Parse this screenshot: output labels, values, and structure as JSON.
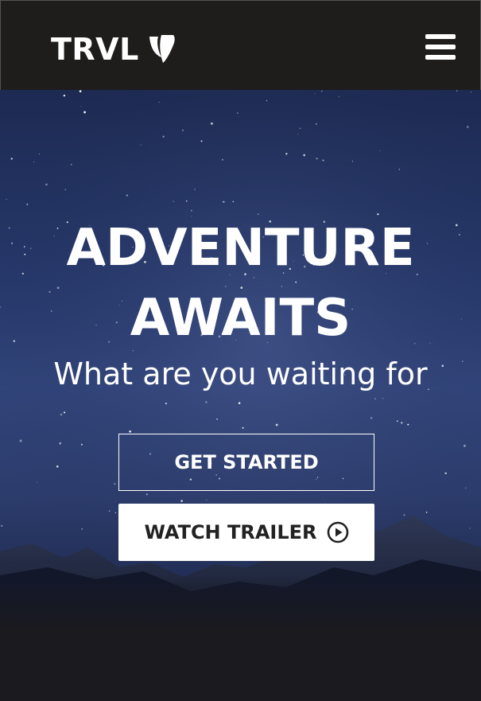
{
  "header": {
    "logo_text": "TRVL",
    "logo_mark_icon": "typo3-shield-icon",
    "menu_icon": "hamburger-menu-icon"
  },
  "hero": {
    "title_line1": "ADVENTURE",
    "title_line2": "AWAITS",
    "subtitle": "What are you waiting for",
    "primary_button_label": "GET STARTED",
    "secondary_button_label": "WATCH TRAILER",
    "secondary_button_icon": "play-circle-icon",
    "background": "starry-night-mountains"
  },
  "colors": {
    "navbar": "#1f1c1c",
    "sky_top": "#1d2a52",
    "sky_mid": "#31447a",
    "text": "#ffffff",
    "button_solid_bg": "#ffffff",
    "button_solid_text": "#222222"
  }
}
